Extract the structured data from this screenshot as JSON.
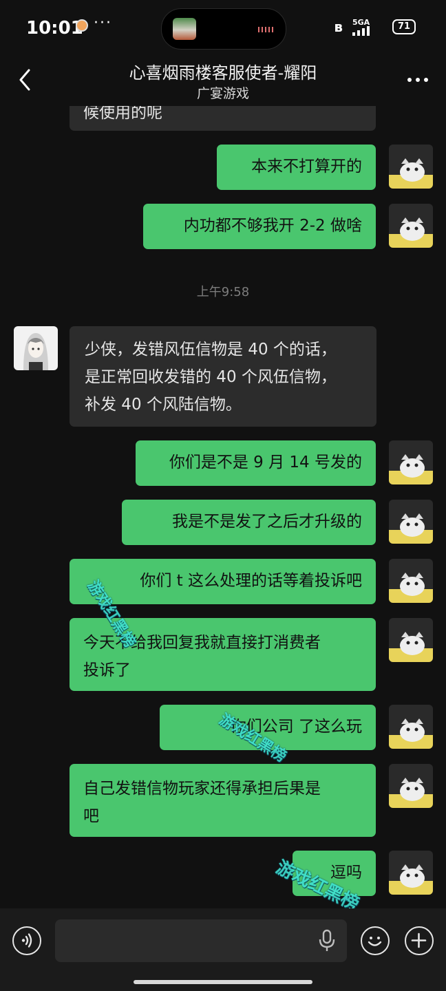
{
  "status_bar": {
    "time": "10:01",
    "overflow": "···",
    "network": "5GA",
    "battery": "71",
    "icons": [
      "notification-icon",
      "bluetooth-icon",
      "signal-icon",
      "battery-icon"
    ]
  },
  "header": {
    "title": "心喜烟雨楼客服使者-耀阳",
    "subtitle": "广宴游戏"
  },
  "messages": [
    {
      "side": "in",
      "text": "候使用的呢"
    },
    {
      "side": "out",
      "text": "本来不打算开的"
    },
    {
      "side": "out",
      "text": "内功都不够我开 2-2 做啥"
    },
    {
      "side": "time",
      "text": "上午9:58"
    },
    {
      "side": "in",
      "lines": [
        "少侠，发错风伍信物是 40 个的话，",
        "是正常回收发错的 40 个风伍信物，",
        "补发 40 个风陆信物。"
      ]
    },
    {
      "side": "out",
      "text": "你们是不是 9 月 14 号发的"
    },
    {
      "side": "out",
      "text": "我是不是发了之后才升级的"
    },
    {
      "side": "out",
      "text": "你们 t  这么处理的话等着投诉吧"
    },
    {
      "side": "out",
      "lines": [
        "今天不给我回复我就直接打消费者",
        "投诉了"
      ]
    },
    {
      "side": "out",
      "text": "你们公司     了这么玩"
    },
    {
      "side": "out",
      "lines": [
        "自己发错信物玩家还得承担后果是",
        "吧"
      ]
    },
    {
      "side": "out",
      "text": "  逗吗"
    }
  ],
  "watermarks": [
    "游戏红黑榜",
    "游戏红黑榜",
    "游戏红黑榜"
  ],
  "input_bar": {
    "left_icon": "voice-icon",
    "field_icon": "microphone-icon",
    "emoji_icon": "emoji-icon",
    "plus_icon": "plus-icon"
  },
  "colors": {
    "background": "#111111",
    "incoming_bubble": "#2c2c2c",
    "outgoing_bubble": "#4ac66e",
    "watermark": "#3fe0d0"
  }
}
